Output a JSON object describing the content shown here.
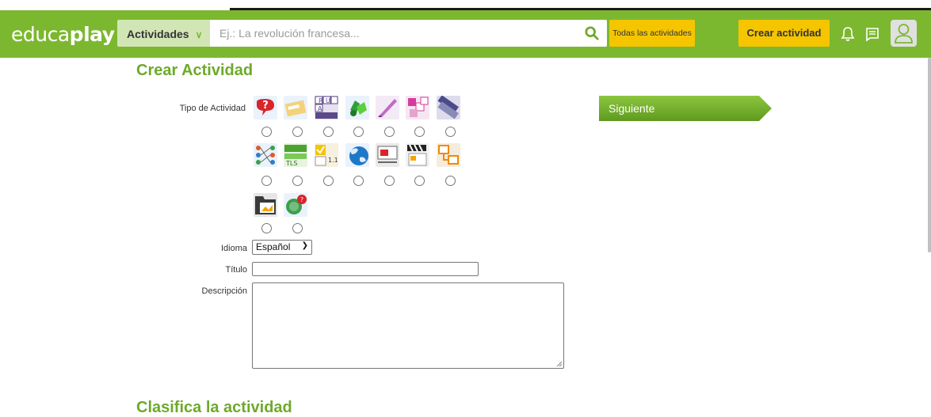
{
  "header": {
    "logo_light": "educa",
    "logo_bold": "play",
    "activities_label": "Actividades",
    "search_placeholder": "Ej.: La revolución francesa...",
    "all_activities_label": "Todas las actividades",
    "create_activity_label": "Crear actividad"
  },
  "form": {
    "title": "Crear Actividad",
    "activity_type_label": "Tipo de Actividad",
    "next_label": "Siguiente",
    "language_label": "Idioma",
    "language_value": "Español",
    "title_label": "Título",
    "title_value": "",
    "description_label": "Descripción",
    "description_value": ""
  },
  "activity_icons": [
    "quiz-icon",
    "fill-blanks-icon",
    "word-search-icon",
    "puzzle-icon",
    "writing-icon",
    "crossword-icon",
    "word-order-icon",
    "relate-icon",
    "alphabet-icon",
    "matching-icon",
    "map-icon",
    "presentation-icon",
    "video-quiz-icon",
    "diagram-icon",
    "slideshow-icon",
    "dialogue-icon"
  ],
  "next_section": {
    "title": "Clasifica la actividad"
  },
  "colors": {
    "brand_green": "#7cb82f",
    "title_green": "#6ea92b",
    "accent_yellow": "#f5c500"
  }
}
